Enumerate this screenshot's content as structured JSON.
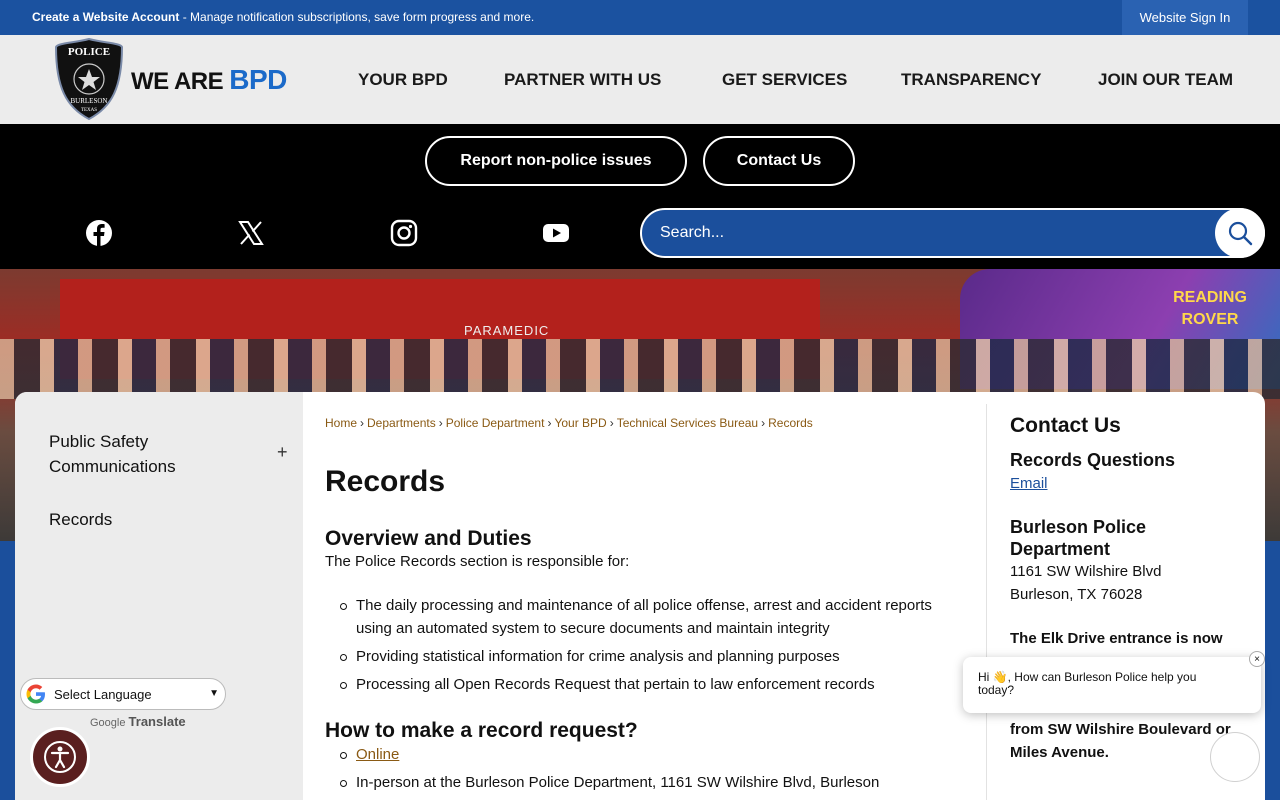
{
  "topbar": {
    "create_account": "Create a Website Account",
    "create_account_desc": " - Manage notification subscriptions, save form progress and more.",
    "sign_in": "Website Sign In"
  },
  "header": {
    "badge_text_top": "POLICE",
    "badge_text_bottom": "BURLESON",
    "badge_text_state": "TEXAS",
    "brand_we": "WE ARE ",
    "brand_bpd": "BPD",
    "nav": [
      "YOUR BPD",
      "PARTNER WITH US",
      "GET SERVICES",
      "TRANSPARENCY",
      "JOIN OUR TEAM"
    ]
  },
  "actions": {
    "report": "Report non-police issues",
    "contact": "Contact Us"
  },
  "social": [
    "facebook-icon",
    "x-icon",
    "instagram-icon",
    "youtube-icon"
  ],
  "search": {
    "placeholder": "Search..."
  },
  "banner": {
    "truck_label": "PARAMEDIC",
    "van_label": "READING ROVER"
  },
  "sidenav": {
    "items": [
      "Public Safety Communications",
      "Records"
    ],
    "expand": "+"
  },
  "breadcrumb": [
    "Home",
    "Departments",
    "Police Department",
    "Your BPD",
    "Technical Services Bureau",
    "Records"
  ],
  "page": {
    "title": "Records",
    "overview_heading": "Overview and Duties",
    "overview_intro": "The Police Records section is responsible for:",
    "duties": [
      "The daily processing and maintenance of all police offense, arrest and accident reports using an automated system to secure documents and maintain integrity",
      "Providing statistical information for crime analysis and planning purposes",
      "Processing all Open Records Request that pertain to law enforcement records"
    ],
    "request_heading": "How to make a record request?",
    "request_options": [
      "Online",
      "In-person at the Burleson Police Department, 1161 SW Wilshire Blvd, Burleson"
    ]
  },
  "contact": {
    "heading": "Contact Us",
    "sub_heading": "Records Questions",
    "email_link": "Email",
    "dept_name": "Burleson Police Department",
    "address1": "1161 SW Wilshire Blvd",
    "address2": "Burleson, TX 76028",
    "notice_start": "The Elk Drive entrance is now",
    "notice_end1": "from SW Wilshire Boulevard or",
    "notice_end2": "Miles Avenue."
  },
  "chat": {
    "message": "Hi 👋, How can Burleson Police help you today?",
    "close": "×"
  },
  "translate": {
    "select_label": "Select Language",
    "powered_by": "Google",
    "translate_word": "Translate"
  },
  "colors": {
    "brand_blue": "#1b4f9c",
    "link_brown": "#8a5a14",
    "black_bar": "#000000"
  }
}
